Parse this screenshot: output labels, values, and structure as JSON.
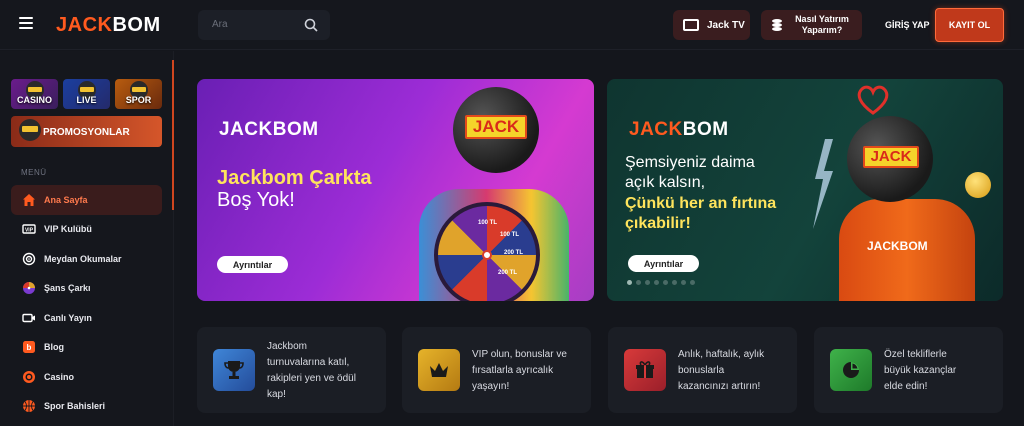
{
  "header": {
    "logo_left": "JACK",
    "logo_right": "BOM",
    "search_placeholder": "Ara",
    "jacktv_label": "Jack TV",
    "howto_label": "Nasıl Yatırım Yaparım?",
    "login_label": "GİRİŞ YAP",
    "register_label": "KAYIT OL"
  },
  "sidebar": {
    "tiles": [
      {
        "label": "CASINO"
      },
      {
        "label": "LIVE"
      },
      {
        "label": "SPOR"
      }
    ],
    "promo_label": "PROMOSYONLAR",
    "menu_title": "MENÜ",
    "items": [
      {
        "label": "Ana Sayfa",
        "icon": "home-icon",
        "active": true
      },
      {
        "label": "VIP Kulübü",
        "icon": "vip-icon"
      },
      {
        "label": "Meydan Okumalar",
        "icon": "target-icon"
      },
      {
        "label": "Şans Çarkı",
        "icon": "wheel-icon"
      },
      {
        "label": "Canlı Yayın",
        "icon": "video-icon"
      },
      {
        "label": "Blog",
        "icon": "blog-icon"
      },
      {
        "label": "Casino",
        "icon": "casino-chip-icon"
      },
      {
        "label": "Spor Bahisleri",
        "icon": "basketball-icon"
      }
    ]
  },
  "banners": [
    {
      "logo_left": "JACK",
      "logo_right": "BOM",
      "title_line1": "Jackbom Çarkta",
      "title_line2": "Boş Yok!",
      "plate_text": "JACK",
      "wheel_labels": [
        "100 TL",
        "100 TL",
        "200 TL",
        "200 TL"
      ],
      "button_label": "Ayrıntılar"
    },
    {
      "logo_left": "JACK",
      "logo_right": "BOM",
      "lines": [
        "Şemsiyeniz daima",
        "açık kalsın,",
        "Çünkü her an fırtına",
        "çıkabilir!"
      ],
      "plate_text": "JACK",
      "hoodie_text": "JACKBOM",
      "button_label": "Ayrıntılar"
    }
  ],
  "cards": [
    {
      "text_lines": [
        "Jackbom",
        "turnuvalarına katıl,",
        "rakipleri yen ve ödül",
        "kap!"
      ],
      "icon": "trophy-icon"
    },
    {
      "text_lines": [
        "VIP olun, bonuslar ve",
        "fırsatlarla ayrıcalık",
        "yaşayın!"
      ],
      "icon": "crown-icon"
    },
    {
      "text_lines": [
        "Anlık, haftalık, aylık",
        "bonuslarla",
        "kazancınızı artırın!"
      ],
      "icon": "gift-icon"
    },
    {
      "text_lines": [
        "Özel tekliflerle",
        "büyük kazançlar",
        "elde edin!"
      ],
      "icon": "pie-chart-icon"
    }
  ],
  "colors": {
    "accent": "#ff5a1f",
    "background": "#14161c",
    "card_bg": "#1b1e25",
    "active_item_bg": "#3a1c1c"
  }
}
